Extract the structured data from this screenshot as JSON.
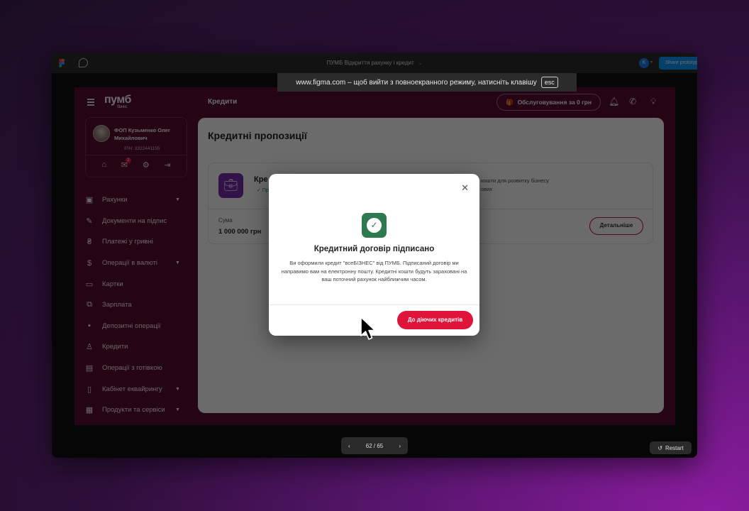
{
  "figma": {
    "file_title": "ПУМБ Відкриття рахунку і кредит",
    "user_initial": "K",
    "share_label": "Share prototype",
    "esc_banner_text": "www.figma.com – щоб вийти з повноекранного режиму, натисніть клавішу",
    "esc_key": "esc",
    "pager_text": "62 / 65",
    "restart_label": "Restart"
  },
  "app": {
    "logo": "пумб",
    "logo_sub": "бізнес",
    "page_crumb": "Кредити",
    "promo_label": "Обслуговування за 0 грн",
    "profile": {
      "name": "ФОП Кузьменко Олег Михайлович",
      "inn": "ІПН: 3322441155",
      "mail_badge": "2"
    },
    "nav": [
      {
        "label": "Рахунки",
        "icon": "accounts-icon",
        "caret": true
      },
      {
        "label": "Документи на підпис",
        "icon": "signature-icon",
        "caret": false
      },
      {
        "label": "Платежі у гривні",
        "icon": "hryvnia-icon",
        "caret": false
      },
      {
        "label": "Операції в валюті",
        "icon": "dollar-icon",
        "caret": true
      },
      {
        "label": "Картки",
        "icon": "card-icon",
        "caret": false
      },
      {
        "label": "Зарплата",
        "icon": "salary-icon",
        "caret": false
      },
      {
        "label": "Депозитні операції",
        "icon": "deposit-icon",
        "caret": false
      },
      {
        "label": "Кредити",
        "icon": "credit-icon",
        "caret": false
      },
      {
        "label": "Операції з готівкою",
        "icon": "cash-icon",
        "caret": false
      },
      {
        "label": "Кабінет еквайрингу",
        "icon": "pos-terminal-icon",
        "caret": true
      },
      {
        "label": "Продукти та сервіси",
        "icon": "briefcase-icon",
        "caret": true
      }
    ],
    "content_title": "Кредитні пропозиції",
    "offer": {
      "name": "Кре",
      "status": "Пр",
      "desc_line1": "кошти для розвитку бізнесу",
      "desc_line2": "ових",
      "sum_label": "Сума",
      "sum_value": "1 000 000 грн",
      "details_label": "Детальніше"
    }
  },
  "modal": {
    "title": "Кредитний договір підписано",
    "text": "Ви оформили кредит \"всеБІЗНЕС\" від ПУМБ. Підписаний договір ми направимо вам на електронну пошту. Кредитні кошти будуть зараховані на ваш поточний рахунок найближчим часом.",
    "button_label": "До діючих кредитів"
  }
}
